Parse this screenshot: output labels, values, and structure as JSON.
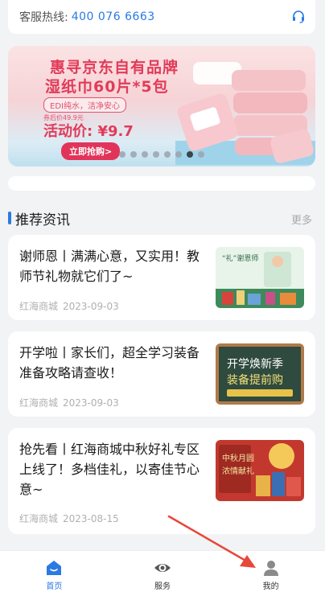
{
  "hotline": {
    "label": "客服热线:",
    "number": "400 076 6663",
    "icon": "headset-icon"
  },
  "banner": {
    "line1": "惠寻京东自有品牌",
    "line2": "湿纸巾60片*5包",
    "line3": "EDI纯水，洁净安心",
    "line4": "券后价49.9元",
    "line5": "活动价: ¥9.7",
    "cta": "立即抢购>",
    "total_slides": 8,
    "active_slide": 7
  },
  "section": {
    "title": "推荐资讯",
    "more": "更多"
  },
  "news": [
    {
      "title": "谢师恩丨满满心意，又实用！教师节礼物就它们了~",
      "source": "红海商城",
      "date": "2023-09-03",
      "thumb_text": "“礼”谢恩师"
    },
    {
      "title": "开学啦丨家长们，超全学习装备准备攻略请查收！",
      "source": "红海商城",
      "date": "2023-09-03",
      "thumb_text": "开学焕新季 装备提前购"
    },
    {
      "title": "抢先看丨红海商城中秋好礼专区上线了！多档佳礼，以寄佳节心意~",
      "source": "红海商城",
      "date": "2023-08-15",
      "thumb_text": "中秋月圆 浓情献礼"
    }
  ],
  "tabs": [
    {
      "label": "首页",
      "icon": "home-icon",
      "active": true
    },
    {
      "label": "服务",
      "icon": "eye-icon",
      "active": false
    },
    {
      "label": "我的",
      "icon": "user-icon",
      "active": false
    }
  ],
  "colors": {
    "accent": "#2a7ae2",
    "banner_red": "#e23b5a",
    "annotation_arrow": "#e8463a"
  }
}
